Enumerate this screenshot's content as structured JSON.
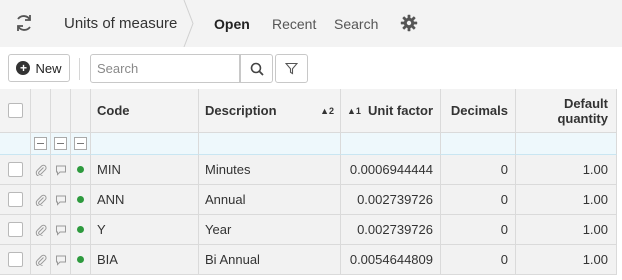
{
  "topbar": {
    "title": "Units of measure",
    "tabs": [
      {
        "label": "Open",
        "active": true
      },
      {
        "label": "Recent",
        "active": false
      },
      {
        "label": "Search",
        "active": false
      }
    ],
    "icons": {
      "refresh": "refresh-icon",
      "settings": "gear-icon"
    }
  },
  "toolbar": {
    "new_label": "New",
    "search_placeholder": "Search",
    "search_value": "",
    "icons": {
      "new": "plus-circle-icon",
      "search": "search-icon",
      "filter": "filter-icon"
    }
  },
  "grid": {
    "columns": {
      "code": "Code",
      "description": "Description",
      "description_sort": "▲2",
      "unit_factor": "Unit factor",
      "unit_factor_sort": "▲1",
      "decimals": "Decimals",
      "default_quantity_line1": "Default",
      "default_quantity_line2": "quantity"
    },
    "status_color": "#2e9a3e",
    "rows": [
      {
        "code": "MIN",
        "description": "Minutes",
        "unit_factor": "0.0006944444",
        "decimals": "0",
        "default_quantity": "1.00"
      },
      {
        "code": "ANN",
        "description": "Annual",
        "unit_factor": "0.002739726",
        "decimals": "0",
        "default_quantity": "1.00"
      },
      {
        "code": "Y",
        "description": "Year",
        "unit_factor": "0.002739726",
        "decimals": "0",
        "default_quantity": "1.00"
      },
      {
        "code": "BIA",
        "description": "Bi Annual",
        "unit_factor": "0.0054644809",
        "decimals": "0",
        "default_quantity": "1.00"
      }
    ]
  }
}
